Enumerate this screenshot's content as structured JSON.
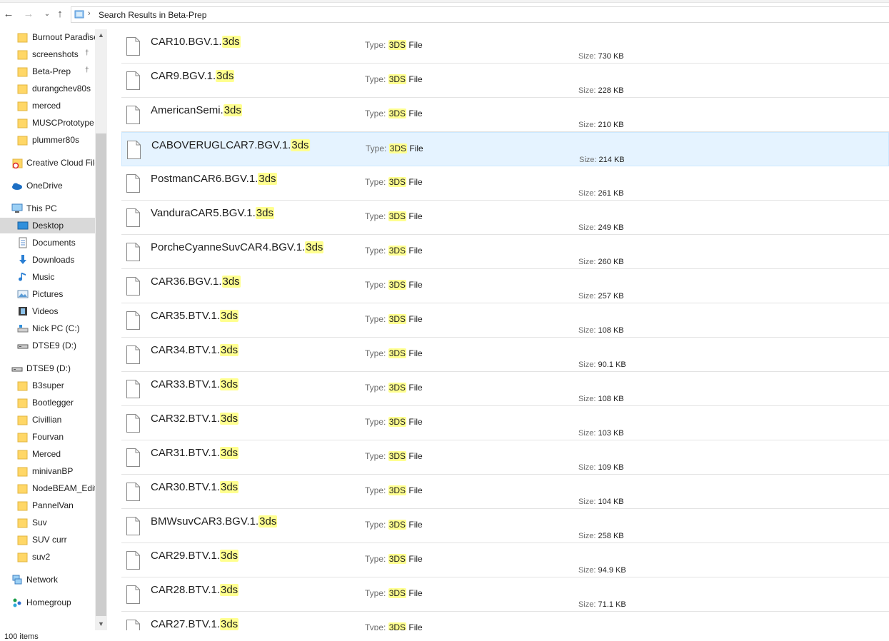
{
  "address": {
    "path_text": "Search Results in Beta-Prep"
  },
  "nav": {
    "quick_access": [
      {
        "label": "Burnout Paradise",
        "pinned": true
      },
      {
        "label": "screenshots",
        "pinned": true
      },
      {
        "label": "Beta-Prep",
        "pinned": true
      },
      {
        "label": "durangchev80s",
        "pinned": false
      },
      {
        "label": "merced",
        "pinned": false
      },
      {
        "label": "MUSCPrototype",
        "pinned": false
      },
      {
        "label": "plummer80s",
        "pinned": false
      }
    ],
    "creative_cloud": "Creative Cloud Files",
    "onedrive": "OneDrive",
    "this_pc": "This PC",
    "pc_items": [
      "Desktop",
      "Documents",
      "Downloads",
      "Music",
      "Pictures",
      "Videos",
      "Nick PC (C:)",
      "DTSE9 (D:)"
    ],
    "drive": "DTSE9 (D:)",
    "drive_items": [
      "B3super",
      "Bootlegger",
      "Civillian",
      "Fourvan",
      "Merced",
      "minivanBP",
      "NodeBEAM_Editor",
      "PannelVan",
      "Suv",
      "SUV curr",
      "suv2"
    ],
    "network": "Network",
    "homegroup": "Homegroup"
  },
  "type_label": "Type:",
  "size_label": "Size:",
  "type_highlight": "3DS",
  "type_rest": " File",
  "files": [
    {
      "stem": "CAR10.BGV.1.",
      "ext": "3ds",
      "size": "730 KB"
    },
    {
      "stem": "CAR9.BGV.1.",
      "ext": "3ds",
      "size": "228 KB"
    },
    {
      "stem": "AmericanSemi.",
      "ext": "3ds",
      "size": "210 KB"
    },
    {
      "stem": "CABOVERUGLCAR7.BGV.1.",
      "ext": "3ds",
      "size": "214 KB"
    },
    {
      "stem": "PostmanCAR6.BGV.1.",
      "ext": "3ds",
      "size": "261 KB"
    },
    {
      "stem": "VanduraCAR5.BGV.1.",
      "ext": "3ds",
      "size": "249 KB"
    },
    {
      "stem": "PorcheCyanneSuvCAR4.BGV.1.",
      "ext": "3ds",
      "size": "260 KB"
    },
    {
      "stem": "CAR36.BGV.1.",
      "ext": "3ds",
      "size": "257 KB"
    },
    {
      "stem": "CAR35.BTV.1.",
      "ext": "3ds",
      "size": "108 KB"
    },
    {
      "stem": "CAR34.BTV.1.",
      "ext": "3ds",
      "size": "90.1 KB"
    },
    {
      "stem": "CAR33.BTV.1.",
      "ext": "3ds",
      "size": "108 KB"
    },
    {
      "stem": "CAR32.BTV.1.",
      "ext": "3ds",
      "size": "103 KB"
    },
    {
      "stem": "CAR31.BTV.1.",
      "ext": "3ds",
      "size": "109 KB"
    },
    {
      "stem": "CAR30.BTV.1.",
      "ext": "3ds",
      "size": "104 KB"
    },
    {
      "stem": "BMWsuvCAR3.BGV.1.",
      "ext": "3ds",
      "size": "258 KB"
    },
    {
      "stem": "CAR29.BTV.1.",
      "ext": "3ds",
      "size": "94.9 KB"
    },
    {
      "stem": "CAR28.BTV.1.",
      "ext": "3ds",
      "size": "71.1 KB"
    },
    {
      "stem": "CAR27.BTV.1.",
      "ext": "3ds",
      "size": ""
    }
  ],
  "status": {
    "item_count": "100 items"
  },
  "colors": {
    "highlight": "#ffff8f",
    "selected_row": "#e5f3ff",
    "folder": "#ffd767"
  }
}
